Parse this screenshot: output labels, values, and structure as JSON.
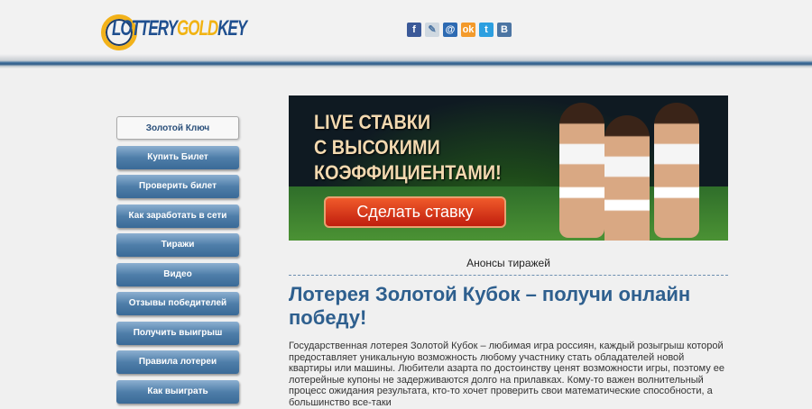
{
  "header": {
    "logo_text": "LOTTERY GOLD KEY",
    "logo_part1": "LOTTERY",
    "logo_part2": "GOLD",
    "logo_part3": "KEY",
    "social": [
      {
        "name": "facebook",
        "glyph": "f",
        "color": "#3b5998"
      },
      {
        "name": "livejournal",
        "glyph": "✎",
        "color": "#cfd8e0"
      },
      {
        "name": "mail-ru",
        "glyph": "@",
        "color": "#2d6ab2"
      },
      {
        "name": "odnoklassniki",
        "glyph": "ok",
        "color": "#f39a2b"
      },
      {
        "name": "twitter",
        "glyph": "t",
        "color": "#2c9fe0"
      },
      {
        "name": "vkontakte",
        "glyph": "B",
        "color": "#4c75a3"
      }
    ]
  },
  "nav": [
    "Золотой Ключ",
    "Купить Билет",
    "Проверить билет",
    "Как заработать в сети",
    "Тиражи",
    "Видео",
    "Отзывы победителей",
    "Получить выигрыш",
    "Правила лотереи",
    "Как выиграть"
  ],
  "banner": {
    "line1": "LIVE СТАВКИ",
    "line2": "С ВЫСОКИМИ",
    "line3": "КОЭФФИЦИЕНТАМИ!",
    "cta": "Сделать ставку"
  },
  "main": {
    "anons": "Анонсы тиражей",
    "title": "Лотерея Золотой Кубок – получи онлайн победу!",
    "body": "Государственная лотерея Золотой Кубок – любимая игра россиян, каждый розыгрыш которой предоставляет уникальную возможность любому участнику стать обладателей новой квартиры или машины. Любители азарта по достоинству ценят возможности игры, поэтому ее лотерейные купоны не задерживаются долго на прилавках. Кому-то важен волнительный процесс ожидания результата, кто-то хочет проверить свои математические способности, а большинство все-таки"
  }
}
